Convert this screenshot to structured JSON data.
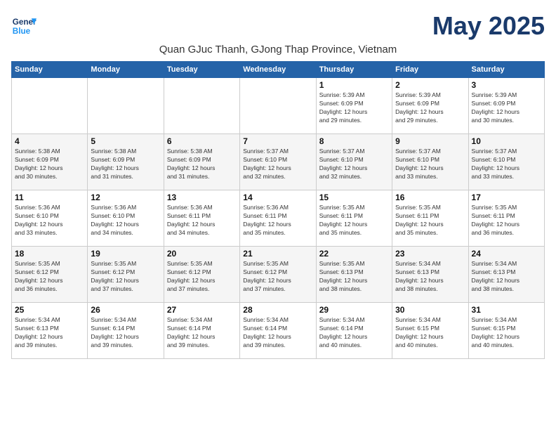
{
  "header": {
    "logo_line1": "General",
    "logo_line2": "Blue",
    "month_title": "May 2025",
    "subtitle": "Quan GJuc Thanh, GJong Thap Province, Vietnam"
  },
  "weekdays": [
    "Sunday",
    "Monday",
    "Tuesday",
    "Wednesday",
    "Thursday",
    "Friday",
    "Saturday"
  ],
  "weeks": [
    [
      {
        "day": "",
        "info": ""
      },
      {
        "day": "",
        "info": ""
      },
      {
        "day": "",
        "info": ""
      },
      {
        "day": "",
        "info": ""
      },
      {
        "day": "1",
        "info": "Sunrise: 5:39 AM\nSunset: 6:09 PM\nDaylight: 12 hours\nand 29 minutes."
      },
      {
        "day": "2",
        "info": "Sunrise: 5:39 AM\nSunset: 6:09 PM\nDaylight: 12 hours\nand 29 minutes."
      },
      {
        "day": "3",
        "info": "Sunrise: 5:39 AM\nSunset: 6:09 PM\nDaylight: 12 hours\nand 30 minutes."
      }
    ],
    [
      {
        "day": "4",
        "info": "Sunrise: 5:38 AM\nSunset: 6:09 PM\nDaylight: 12 hours\nand 30 minutes."
      },
      {
        "day": "5",
        "info": "Sunrise: 5:38 AM\nSunset: 6:09 PM\nDaylight: 12 hours\nand 31 minutes."
      },
      {
        "day": "6",
        "info": "Sunrise: 5:38 AM\nSunset: 6:09 PM\nDaylight: 12 hours\nand 31 minutes."
      },
      {
        "day": "7",
        "info": "Sunrise: 5:37 AM\nSunset: 6:10 PM\nDaylight: 12 hours\nand 32 minutes."
      },
      {
        "day": "8",
        "info": "Sunrise: 5:37 AM\nSunset: 6:10 PM\nDaylight: 12 hours\nand 32 minutes."
      },
      {
        "day": "9",
        "info": "Sunrise: 5:37 AM\nSunset: 6:10 PM\nDaylight: 12 hours\nand 33 minutes."
      },
      {
        "day": "10",
        "info": "Sunrise: 5:37 AM\nSunset: 6:10 PM\nDaylight: 12 hours\nand 33 minutes."
      }
    ],
    [
      {
        "day": "11",
        "info": "Sunrise: 5:36 AM\nSunset: 6:10 PM\nDaylight: 12 hours\nand 33 minutes."
      },
      {
        "day": "12",
        "info": "Sunrise: 5:36 AM\nSunset: 6:10 PM\nDaylight: 12 hours\nand 34 minutes."
      },
      {
        "day": "13",
        "info": "Sunrise: 5:36 AM\nSunset: 6:11 PM\nDaylight: 12 hours\nand 34 minutes."
      },
      {
        "day": "14",
        "info": "Sunrise: 5:36 AM\nSunset: 6:11 PM\nDaylight: 12 hours\nand 35 minutes."
      },
      {
        "day": "15",
        "info": "Sunrise: 5:35 AM\nSunset: 6:11 PM\nDaylight: 12 hours\nand 35 minutes."
      },
      {
        "day": "16",
        "info": "Sunrise: 5:35 AM\nSunset: 6:11 PM\nDaylight: 12 hours\nand 35 minutes."
      },
      {
        "day": "17",
        "info": "Sunrise: 5:35 AM\nSunset: 6:11 PM\nDaylight: 12 hours\nand 36 minutes."
      }
    ],
    [
      {
        "day": "18",
        "info": "Sunrise: 5:35 AM\nSunset: 6:12 PM\nDaylight: 12 hours\nand 36 minutes."
      },
      {
        "day": "19",
        "info": "Sunrise: 5:35 AM\nSunset: 6:12 PM\nDaylight: 12 hours\nand 37 minutes."
      },
      {
        "day": "20",
        "info": "Sunrise: 5:35 AM\nSunset: 6:12 PM\nDaylight: 12 hours\nand 37 minutes."
      },
      {
        "day": "21",
        "info": "Sunrise: 5:35 AM\nSunset: 6:12 PM\nDaylight: 12 hours\nand 37 minutes."
      },
      {
        "day": "22",
        "info": "Sunrise: 5:35 AM\nSunset: 6:13 PM\nDaylight: 12 hours\nand 38 minutes."
      },
      {
        "day": "23",
        "info": "Sunrise: 5:34 AM\nSunset: 6:13 PM\nDaylight: 12 hours\nand 38 minutes."
      },
      {
        "day": "24",
        "info": "Sunrise: 5:34 AM\nSunset: 6:13 PM\nDaylight: 12 hours\nand 38 minutes."
      }
    ],
    [
      {
        "day": "25",
        "info": "Sunrise: 5:34 AM\nSunset: 6:13 PM\nDaylight: 12 hours\nand 39 minutes."
      },
      {
        "day": "26",
        "info": "Sunrise: 5:34 AM\nSunset: 6:14 PM\nDaylight: 12 hours\nand 39 minutes."
      },
      {
        "day": "27",
        "info": "Sunrise: 5:34 AM\nSunset: 6:14 PM\nDaylight: 12 hours\nand 39 minutes."
      },
      {
        "day": "28",
        "info": "Sunrise: 5:34 AM\nSunset: 6:14 PM\nDaylight: 12 hours\nand 39 minutes."
      },
      {
        "day": "29",
        "info": "Sunrise: 5:34 AM\nSunset: 6:14 PM\nDaylight: 12 hours\nand 40 minutes."
      },
      {
        "day": "30",
        "info": "Sunrise: 5:34 AM\nSunset: 6:15 PM\nDaylight: 12 hours\nand 40 minutes."
      },
      {
        "day": "31",
        "info": "Sunrise: 5:34 AM\nSunset: 6:15 PM\nDaylight: 12 hours\nand 40 minutes."
      }
    ]
  ]
}
